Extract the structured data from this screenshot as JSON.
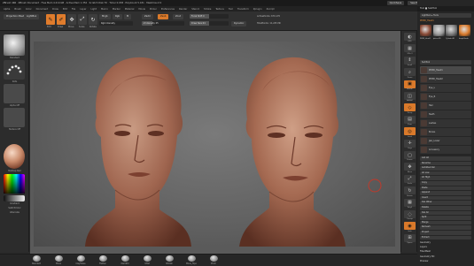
{
  "titlebar": {
    "title": "ZBrush 4R6 · ZBrush Document · Free Mem 4.214 GB · Active Mem 1.352 · Scratch Disk 70 · Timer 0.038 · PolyCount 5.431 · MeshCount 2",
    "quicksave": "QuickSave",
    "see_through": "See-through 0",
    "menus": "Menus",
    "script": "DefaultZScript"
  },
  "menubar": [
    "Alpha",
    "Brush",
    "Color",
    "Document",
    "Draw",
    "Edit",
    "File",
    "Layer",
    "Light",
    "Macro",
    "Marker",
    "Material",
    "Movie",
    "Picker",
    "Preferences",
    "Render",
    "Stencil",
    "Stroke",
    "Texture",
    "Tool",
    "Transform",
    "Zplugin",
    "Zscript"
  ],
  "toolbar": {
    "projection_master": "Projection Master",
    "lightbox": "LightBox",
    "tools": [
      {
        "icon": "edit-icon",
        "glyph": "✎",
        "label": "Edit",
        "active": true
      },
      {
        "icon": "draw-icon",
        "glyph": "✐",
        "label": "Draw",
        "active": true
      },
      {
        "icon": "move-icon",
        "glyph": "✥",
        "label": "Move",
        "active": false
      },
      {
        "icon": "scale-icon",
        "glyph": "⤢",
        "label": "Scale",
        "active": false
      },
      {
        "icon": "rotate-icon",
        "glyph": "↻",
        "label": "Rotate",
        "active": false
      }
    ],
    "mrgb": "Mrgb",
    "rgb": "Rgb",
    "m": "M",
    "rgb_intensity": "Rgb Intensity",
    "zadd": "Zadd",
    "zsub": "Zsub",
    "zcut": "Zcut",
    "z_intensity": "Z Intensity 25",
    "focal_shift": "Focal Shift 0",
    "draw_size": "Draw Size 64",
    "dynamic": "Dynamic",
    "active_points": "ActivePoints: 679,170",
    "total_points": "TotalPoints: 11,245 Mil",
    "z_intensity_level": 0.25,
    "draw_size_level": 0.5,
    "focal_shift_level": 0.5
  },
  "left": {
    "brush": "Standard",
    "stroke": "Dots",
    "alpha": "Alpha Off",
    "texture": "Texture Off",
    "material": "MatCap Red",
    "gradient": "Gradient",
    "switch_color": "SwitchColor",
    "alternate": "Alternate"
  },
  "right": {
    "buttons": [
      {
        "icon": "bpr-icon",
        "glyph": "◐",
        "label": "BPR",
        "accent": false
      },
      {
        "icon": "spix-icon",
        "glyph": "▦",
        "label": "SPix 3",
        "accent": false
      },
      {
        "icon": "scroll-icon",
        "glyph": "⇕",
        "label": "Scroll",
        "accent": false
      },
      {
        "icon": "zoom-icon",
        "glyph": "⌕",
        "label": "Zoom",
        "accent": false
      },
      {
        "icon": "actual-icon",
        "glyph": "▣",
        "label": "Actual",
        "accent": true
      },
      {
        "icon": "aahalf-icon",
        "glyph": "◫",
        "label": "AAHalf",
        "accent": false
      },
      {
        "icon": "persp-icon",
        "glyph": "◇",
        "label": "Persp",
        "accent": true
      },
      {
        "icon": "floor-icon",
        "glyph": "▤",
        "label": "Floor",
        "accent": false
      },
      {
        "icon": "local-icon",
        "glyph": "◎",
        "label": "Local",
        "accent": true
      },
      {
        "icon": "xyz-icon",
        "glyph": "✛",
        "label": "Gxyz",
        "accent": false
      },
      {
        "icon": "frame-icon",
        "glyph": "▢",
        "label": "Frame",
        "accent": false
      },
      {
        "icon": "move-view-icon",
        "glyph": "✥",
        "label": "Move",
        "accent": false
      },
      {
        "icon": "scale-view-icon",
        "glyph": "⤢",
        "label": "Scale",
        "accent": false
      },
      {
        "icon": "rotate-view-icon",
        "glyph": "↻",
        "label": "Rotate",
        "accent": false
      },
      {
        "icon": "polyf-icon",
        "glyph": "▦",
        "label": "PolyF",
        "accent": false
      },
      {
        "icon": "transp-icon",
        "glyph": "◌",
        "label": "Transp",
        "accent": false
      },
      {
        "icon": "solo-icon",
        "glyph": "◉",
        "label": "Solo",
        "accent": true
      },
      {
        "icon": "xpose-icon",
        "glyph": "⊞",
        "label": "Xpose",
        "accent": false
      }
    ]
  },
  "tray": {
    "header": "Tool   ■ SubTool",
    "lightbox_tools": "Lightbox ▸ Tools",
    "tool_name": "PM3D_Head1",
    "thumbs": [
      "PM3D_Head1",
      "Sphere3D",
      "Cylinder3D",
      "SimpleBrush"
    ],
    "subtool_title": "SubTool",
    "subtools": [
      "PM3D_Head1",
      "PM3D_Head2",
      "Eye_L",
      "Eye_R",
      "Hair",
      "Teeth",
      "Lashes",
      "Brows",
      "Jaw_Lower",
      "Accessory"
    ],
    "rows": [
      "List All",
      "Rename",
      "AutoReorder",
      "All Low",
      "All High",
      "Copy",
      "Paste",
      "Append",
      "Insert",
      "Del Other",
      "Delete",
      "Del All",
      "Split",
      "Merge",
      "Remesh",
      "Project",
      "Extract"
    ],
    "sections": [
      "Geometry",
      "Layers",
      "FiberMesh",
      "Geometry HD",
      "Preview"
    ]
  },
  "bottom": {
    "brushes": [
      "Standard",
      "Move",
      "ClayTubes",
      "Flatten",
      "DamStd",
      "Inflat",
      "hPolish",
      "Move_Topo",
      "Pinch"
    ]
  }
}
